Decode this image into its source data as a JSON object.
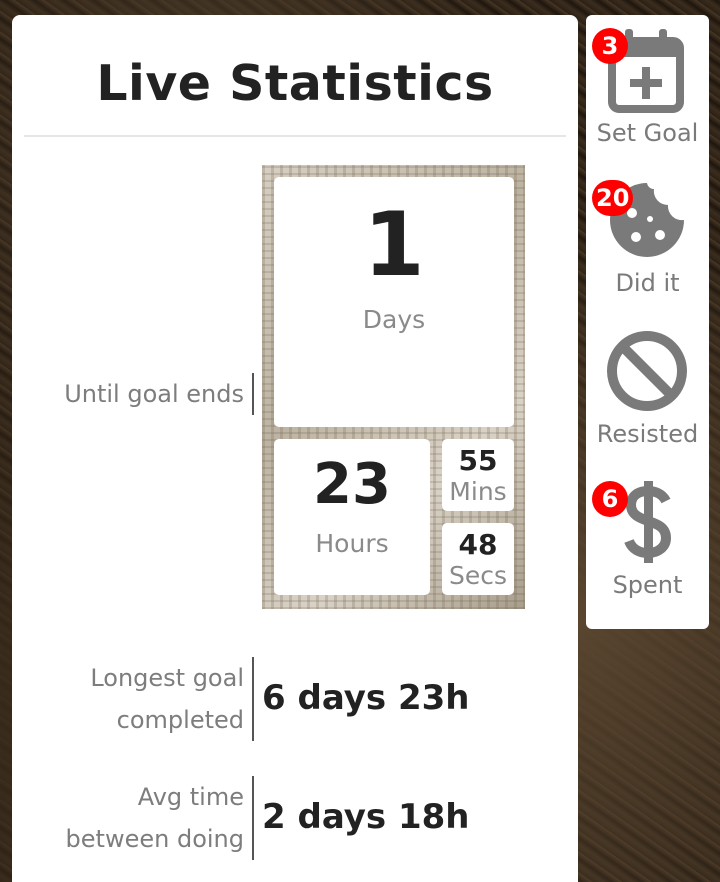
{
  "stats": {
    "title": "Live Statistics",
    "countdown": {
      "label": "Until goal ends",
      "days": {
        "value": "1",
        "unit": "Days"
      },
      "hours": {
        "value": "23",
        "unit": "Hours"
      },
      "mins": {
        "value": "55",
        "unit": "Mins"
      },
      "secs": {
        "value": "48",
        "unit": "Secs"
      }
    },
    "longest": {
      "label_line1": "Longest goal",
      "label_line2": "completed",
      "value": "6 days 23h"
    },
    "avg": {
      "label_line1": "Avg time",
      "label_line2": "between doing",
      "value": "2 days 18h"
    }
  },
  "sidebar": {
    "set_goal": {
      "label": "Set Goal",
      "badge": "3",
      "icon": "calendar-plus-icon"
    },
    "did_it": {
      "label": "Did it",
      "badge": "20",
      "icon": "cookie-bite-icon"
    },
    "resisted": {
      "label": "Resisted",
      "icon": "ban-icon"
    },
    "spent": {
      "label": "Spent",
      "badge": "6",
      "icon": "dollar-sign-icon"
    }
  },
  "colors": {
    "icon_gray": "#7a7a7a",
    "badge_red": "#ff0000",
    "text_dark": "#222222",
    "text_muted": "#7d7d7d"
  }
}
